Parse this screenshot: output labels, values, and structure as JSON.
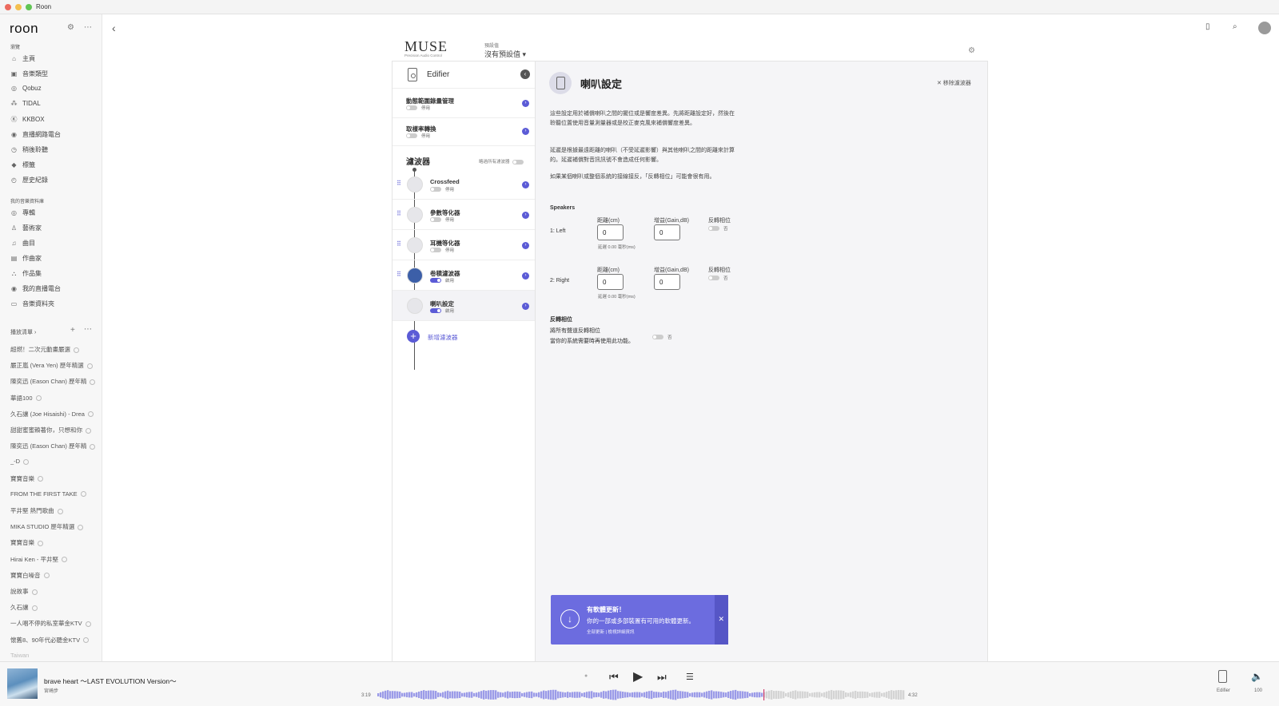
{
  "window": {
    "title": "Roon"
  },
  "sidebar": {
    "logo": "roon",
    "browse_heading": "瀏覽",
    "browse_items": [
      {
        "icon": "home-icon",
        "glyph": "⌂",
        "label": "主頁"
      },
      {
        "icon": "genre-icon",
        "glyph": "▣",
        "label": "音樂類型"
      },
      {
        "icon": "qobuz-icon",
        "glyph": "◎",
        "label": "Qobuz"
      },
      {
        "icon": "tidal-icon",
        "glyph": "⁂",
        "label": "TIDAL"
      },
      {
        "icon": "kkbox-icon",
        "glyph": "Ⓚ",
        "label": "KKBOX"
      },
      {
        "icon": "radio-icon",
        "glyph": "◉",
        "label": "直播網路電台"
      },
      {
        "icon": "listen-later-icon",
        "glyph": "◷",
        "label": "稍後聆聽"
      },
      {
        "icon": "tag-icon",
        "glyph": "◆",
        "label": "標籤"
      },
      {
        "icon": "history-icon",
        "glyph": "◴",
        "label": "歷史紀錄"
      }
    ],
    "library_heading": "我的音樂資料庫",
    "library_items": [
      {
        "icon": "album-icon",
        "glyph": "◎",
        "label": "專輯"
      },
      {
        "icon": "artist-icon",
        "glyph": "♙",
        "label": "藝術家"
      },
      {
        "icon": "track-icon",
        "glyph": "♫",
        "label": "曲目"
      },
      {
        "icon": "composer-icon",
        "glyph": "▤",
        "label": "作曲家"
      },
      {
        "icon": "composition-icon",
        "glyph": "⛬",
        "label": "作品集"
      },
      {
        "icon": "my-radio-icon",
        "glyph": "◉",
        "label": "我的直播電台"
      },
      {
        "icon": "folder-icon",
        "glyph": "▭",
        "label": "音樂資料夾"
      }
    ],
    "playlists_heading": "播放清單 ›",
    "playlists": [
      "超燃！二次元動畫嚴選",
      "嚴正嵐 (Vera Yen) 歷年精選",
      "陳奕迅 (Eason Chan) 歷年精",
      "華語100",
      "久石讓 (Joe Hisaishi) - Drea",
      "甜甜蜜蜜賴著你，只想和你",
      "陳奕迅 (Eason Chan) 歷年精",
      "_-D",
      "寶寶音樂",
      "FROM THE FIRST TAKE",
      "平井堅 熱門歌曲",
      "MIKA STUDIO 歷年精選",
      "寶寶音樂",
      "Hirai Ken - 平井堅",
      "寶寶白噪音",
      "說故事",
      "久石讓",
      "一人唱不停的私室華金KTV",
      "懷舊8、90年代必聽金KTV",
      "Taiwan"
    ]
  },
  "header": {
    "brand_main": "MUSE",
    "brand_sub": "Precision Audio Control",
    "preset_label": "預設值",
    "preset_value": "沒有預設值 ▾"
  },
  "dsp": {
    "device_name": "Edifier",
    "top_settings": [
      {
        "name": "動態範圍錄量管理",
        "state": "停用",
        "on": false
      },
      {
        "name": "取樣率轉換",
        "state": "停用",
        "on": false
      }
    ],
    "filters_title": "濾波器",
    "bypass_label": "略過所有濾波器",
    "filters": [
      {
        "name": "Crossfeed",
        "state": "停用",
        "on": false
      },
      {
        "name": "參數等化器",
        "state": "停用",
        "on": false
      },
      {
        "name": "耳機等化器",
        "state": "停用",
        "on": false
      },
      {
        "name": "卷積濾波器",
        "state": "啟用",
        "on": true
      },
      {
        "name": "喇叭設定",
        "state": "啟用",
        "on": true
      }
    ],
    "add_filter": "新增濾波器"
  },
  "detail": {
    "title": "喇叭設定",
    "remove": "✕ 移除濾波器",
    "para1": "這些設定用於補償喇叭之間的擺位或是響度差異。先將距離設定好，然後在聆聽位置使用音量測量器或是校正麥克風來補償響度差異。",
    "para2": "延遲是根據最遠距離的喇叭（不受延遲影響）與其他喇叭之間的距離來計算的。延遲補償對音訊訊號不會造成任何影響。",
    "para3": "如果某個喇叭或整個系統的接線接反，「反轉相位」可能會很有用。",
    "speakers_heading": "Speakers",
    "col_distance": "距離(cm)",
    "col_gain": "增益(Gain,dB)",
    "col_invert": "反轉相位",
    "speakers": [
      {
        "label": "1: Left",
        "distance": "0",
        "gain": "0",
        "delay": "延遲 0.00 毫秒(ms)",
        "invert": "否"
      },
      {
        "label": "2: Right",
        "distance": "0",
        "gain": "0",
        "delay": "延遲 0.00 毫秒(ms)",
        "invert": "否"
      }
    ],
    "phase_heading": "反轉相位",
    "phase_line1": "將所有聲道反轉相位",
    "phase_line2": "當你的系統需要時再使用此功能。",
    "phase_state": "否"
  },
  "update_toast": {
    "title": "有軟體更新！",
    "body": "你的一部或多部裝置有可用的軟體更新。",
    "links": "全部更新 | 檢視詳細資訊",
    "close": "✕"
  },
  "player": {
    "song": "brave heart 〜LAST EVOLUTION Version〜",
    "artist": "宮崎步",
    "elapsed": "3:19",
    "total": "4:32",
    "progress": 0.73,
    "zone": "Edifier",
    "volume": "100"
  },
  "colors": {
    "accent": "#5b5bd6",
    "toast": "#6c6cdf"
  }
}
